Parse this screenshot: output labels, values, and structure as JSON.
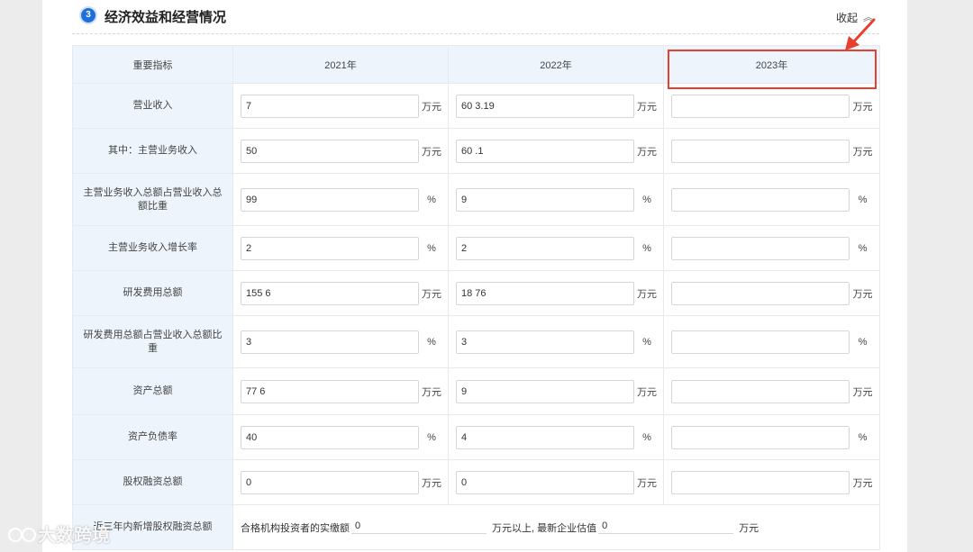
{
  "section": {
    "step_number": "3",
    "title": "经济效益和经营情况",
    "collapse_label": "收起"
  },
  "table": {
    "header": {
      "indicator": "重要指标",
      "y2021": "2021年",
      "y2022": "2022年",
      "y2023": "2023年"
    },
    "rows": [
      {
        "label": "营业收入",
        "v2021": "7",
        "v2022": "60 3.19",
        "v2023": "",
        "unit": "万元"
      },
      {
        "label": "其中：主营业务收入",
        "v2021": "50",
        "v2022": "60 .1",
        "v2023": "",
        "unit": "万元"
      },
      {
        "label": "主营业务收入总额占营业收入总额比重",
        "v2021": "99",
        "v2022": "9",
        "v2023": "",
        "unit": "%"
      },
      {
        "label": "主营业务收入增长率",
        "v2021": "2",
        "v2022": "2",
        "v2023": "",
        "unit": "%"
      },
      {
        "label": "研发费用总额",
        "v2021": "155 6",
        "v2022": "18 76",
        "v2023": "",
        "unit": "万元"
      },
      {
        "label": "研发费用总额占营业收入总额比重",
        "v2021": "3",
        "v2022": "3",
        "v2023": "",
        "unit": "%"
      },
      {
        "label": "资产总额",
        "v2021": "77 6",
        "v2022": "9",
        "v2023": "",
        "unit": "万元"
      },
      {
        "label": "资产负债率",
        "v2021": "40",
        "v2022": "4",
        "v2023": "",
        "unit": "%"
      },
      {
        "label": "股权融资总额",
        "v2021": "0",
        "v2022": "0",
        "v2023": "",
        "unit": "万元"
      }
    ],
    "last_row": {
      "label": "近三年内新增股权融资总额",
      "qualified_label": "合格机构投资者的实缴额",
      "qualified_value": "0",
      "mid_text": "万元以上, 最新企业估值",
      "valuation_value": "0",
      "unit": "万元"
    }
  },
  "watermark": {
    "text": "大数跨境"
  },
  "colors": {
    "accent": "#1e6fd9",
    "highlight": "#e8402f",
    "header_bg": "#eef4fc"
  }
}
